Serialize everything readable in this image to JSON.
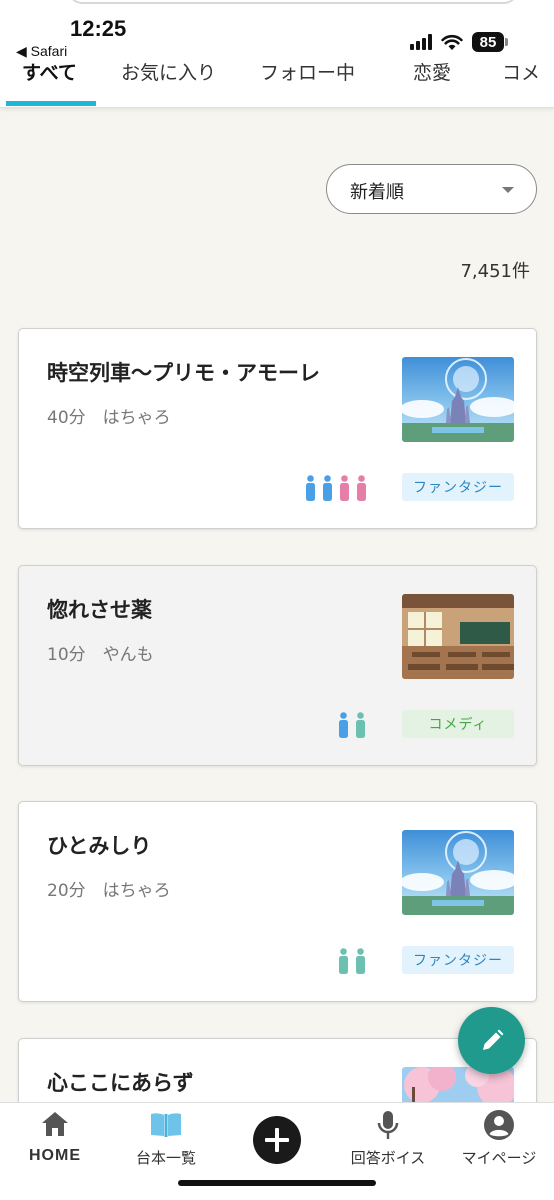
{
  "status_bar": {
    "time": "12:25",
    "back_app": "◀ Safari",
    "battery": "85"
  },
  "tabs": [
    {
      "label": "すべて",
      "active": true
    },
    {
      "label": "お気に入り",
      "active": false
    },
    {
      "label": "フォロー中",
      "active": false
    },
    {
      "label": "恋愛",
      "active": false
    },
    {
      "label": "コメ",
      "active": false
    }
  ],
  "sort": {
    "selected": "新着順"
  },
  "result_count": "7,451件",
  "cards": [
    {
      "title": "時空列車〜プリモ・アモーレ",
      "meta": "40分　はちゃろ",
      "genre": "ファンタジー",
      "genre_type": "fantasy",
      "thumbnail": "fantasy-castle",
      "cast": [
        "male",
        "male",
        "female",
        "female"
      ]
    },
    {
      "title": "惚れさせ薬",
      "meta": "10分　やんも",
      "genre": "コメディ",
      "genre_type": "comedy",
      "thumbnail": "classroom",
      "cast": [
        "male",
        "any"
      ]
    },
    {
      "title": "ひとみしり",
      "meta": "20分　はちゃろ",
      "genre": "ファンタジー",
      "genre_type": "fantasy",
      "thumbnail": "fantasy-castle",
      "cast": [
        "any",
        "any"
      ]
    },
    {
      "title": "心ここにあらず",
      "meta": "",
      "genre": "",
      "genre_type": "",
      "thumbnail": "cherry-blossom",
      "cast": []
    }
  ],
  "bottom_nav": [
    {
      "label": "HOME",
      "icon": "home-icon"
    },
    {
      "label": "台本一覧",
      "icon": "open-book-icon"
    },
    {
      "label": "",
      "icon": "plus-circle-icon"
    },
    {
      "label": "回答ボイス",
      "icon": "microphone-icon"
    },
    {
      "label": "マイページ",
      "icon": "account-circle-icon"
    }
  ],
  "colors": {
    "accent": "#1fb7d6",
    "fab": "#1f9a8c",
    "male": "#4aa0e6",
    "female": "#e67fa8",
    "any": "#6cc0b0",
    "fantasy_badge_bg": "#e3f3fd",
    "comedy_badge_bg": "#e3f2e3"
  }
}
